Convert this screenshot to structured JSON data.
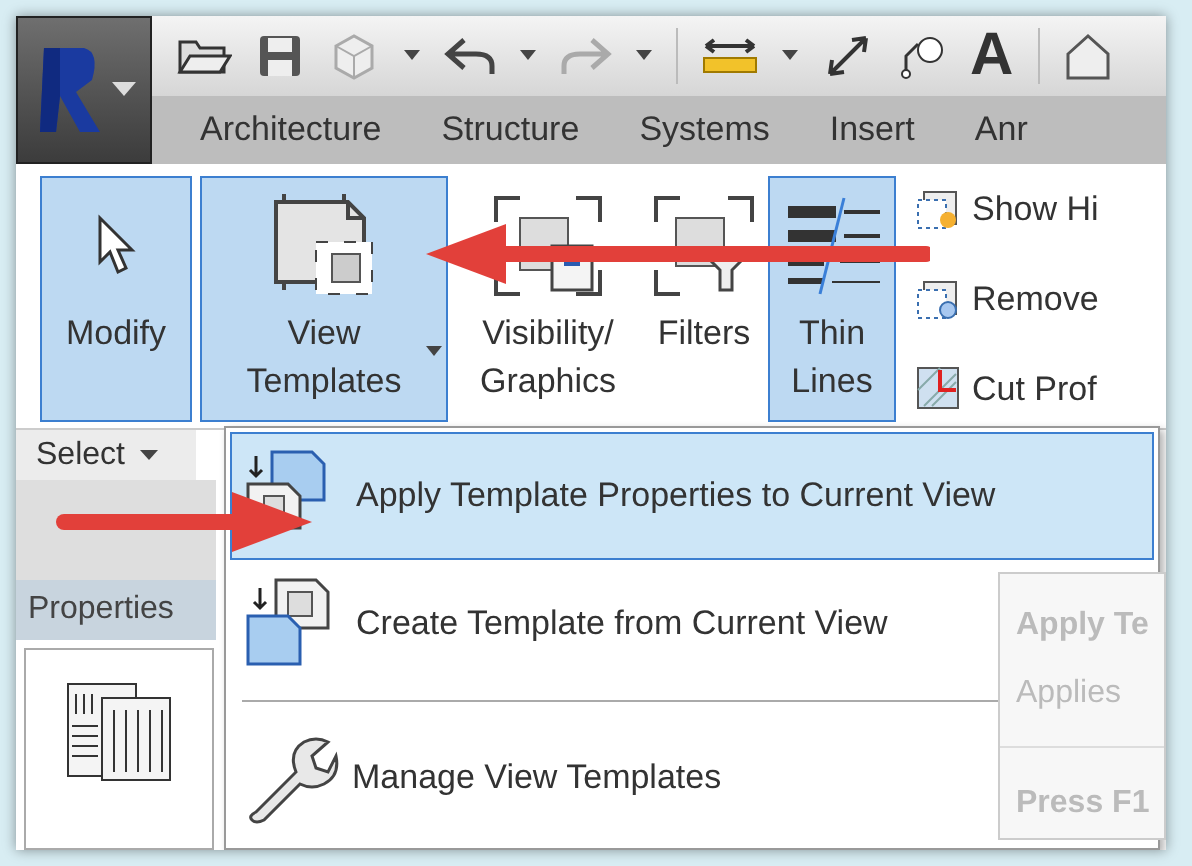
{
  "quick_access_toolbar": {
    "text_tool": "A"
  },
  "ribbon_tabs": [
    {
      "label": "Architecture"
    },
    {
      "label": "Structure"
    },
    {
      "label": "Systems"
    },
    {
      "label": "Insert"
    },
    {
      "label": "Anr"
    }
  ],
  "ribbon_buttons": [
    {
      "kind": "large",
      "label": "Modify",
      "active": true,
      "dropdown": false
    },
    {
      "kind": "large",
      "label": "View\nTemplates",
      "active": true,
      "dropdown": true
    },
    {
      "kind": "large",
      "label": "Visibility/\nGraphics",
      "active": false,
      "dropdown": false
    },
    {
      "kind": "large",
      "label": "Filters",
      "active": false,
      "dropdown": false
    },
    {
      "kind": "large",
      "label": "Thin\nLines",
      "active": true,
      "dropdown": false
    }
  ],
  "small_buttons": [
    {
      "label": "Show Hi"
    },
    {
      "label": "Remove"
    },
    {
      "label": "Cut Prof"
    }
  ],
  "panel_label": "Select",
  "properties_label": "Properties",
  "menu": {
    "items": [
      {
        "label": "Apply Template Properties to Current View",
        "selected": true
      },
      {
        "label": "Create Template from Current View",
        "selected": false
      },
      {
        "label": "Manage View Templates",
        "selected": false
      }
    ]
  },
  "tooltip": {
    "title": "Apply Te",
    "description": "Applies",
    "help": "Press F1"
  }
}
